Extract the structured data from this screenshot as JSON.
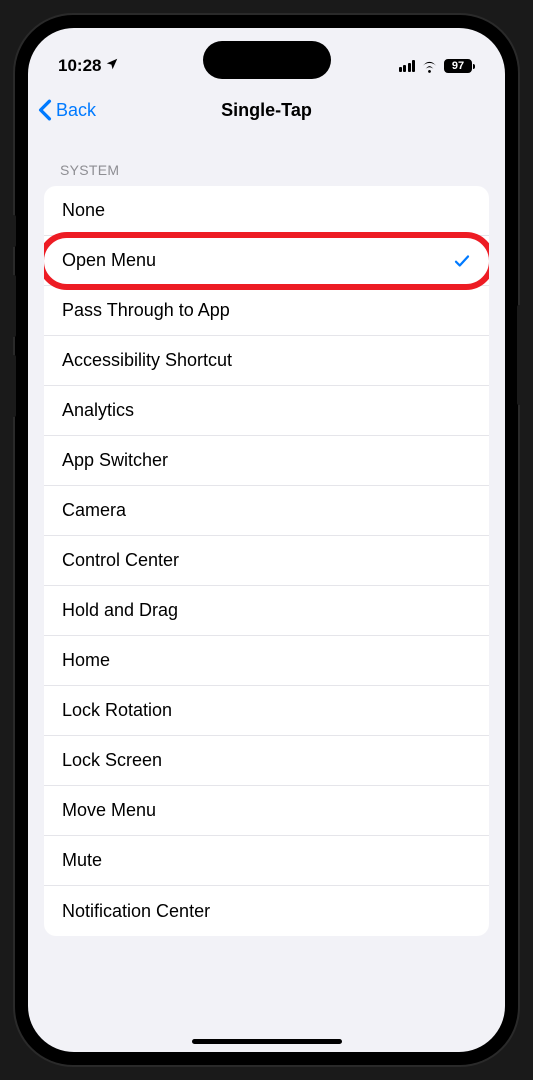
{
  "status": {
    "time": "10:28",
    "battery": "97"
  },
  "nav": {
    "back_label": "Back",
    "title": "Single-Tap"
  },
  "section": {
    "header": "SYSTEM"
  },
  "items": [
    {
      "label": "None",
      "selected": false
    },
    {
      "label": "Open Menu",
      "selected": true,
      "highlighted": true
    },
    {
      "label": "Pass Through to App",
      "selected": false
    },
    {
      "label": "Accessibility Shortcut",
      "selected": false
    },
    {
      "label": "Analytics",
      "selected": false
    },
    {
      "label": "App Switcher",
      "selected": false
    },
    {
      "label": "Camera",
      "selected": false
    },
    {
      "label": "Control Center",
      "selected": false
    },
    {
      "label": "Hold and Drag",
      "selected": false
    },
    {
      "label": "Home",
      "selected": false
    },
    {
      "label": "Lock Rotation",
      "selected": false
    },
    {
      "label": "Lock Screen",
      "selected": false
    },
    {
      "label": "Move Menu",
      "selected": false
    },
    {
      "label": "Mute",
      "selected": false
    },
    {
      "label": "Notification Center",
      "selected": false
    }
  ]
}
